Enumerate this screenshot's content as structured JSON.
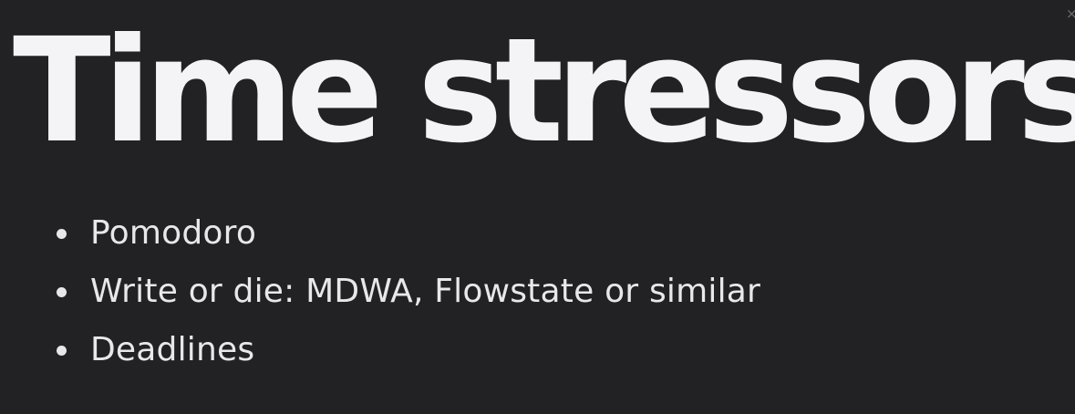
{
  "slide": {
    "title": "Time stressors",
    "bullets": [
      {
        "text": "Pomodoro"
      },
      {
        "text": "Write or die: MDWA, Flowstate or similar"
      },
      {
        "text": "Deadlines"
      }
    ]
  },
  "icons": {
    "close": "close-icon"
  },
  "colors": {
    "background": "#222124",
    "title": "#f4f3f5",
    "body_text": "#e8e7ea"
  }
}
